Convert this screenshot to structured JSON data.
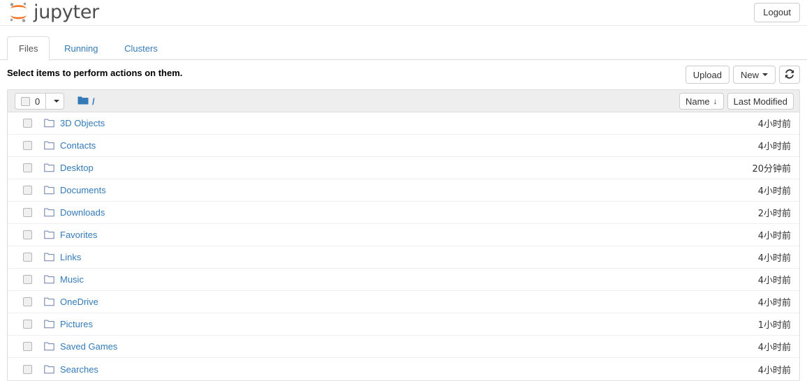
{
  "header": {
    "brand": "jupyter",
    "logo_icon": "jupyter-logo-icon",
    "logout_label": "Logout"
  },
  "tabs": [
    {
      "label": "Files",
      "active": true
    },
    {
      "label": "Running",
      "active": false
    },
    {
      "label": "Clusters",
      "active": false
    }
  ],
  "action_bar": {
    "hint": "Select items to perform actions on them.",
    "upload_label": "Upload",
    "new_label": "New",
    "refresh_icon": "refresh-icon"
  },
  "list_toolbar": {
    "select_count": "0",
    "select_caret_icon": "chevron-down-icon",
    "breadcrumb_folder_icon": "folder-filled-icon",
    "breadcrumb_root": "/",
    "sort_name_label": "Name",
    "sort_name_arrow": "↓",
    "sort_modified_label": "Last Modified"
  },
  "files": [
    {
      "name": "3D Objects",
      "icon": "folder-icon",
      "modified": "4小时前"
    },
    {
      "name": "Contacts",
      "icon": "folder-icon",
      "modified": "4小时前"
    },
    {
      "name": "Desktop",
      "icon": "folder-icon",
      "modified": "20分钟前"
    },
    {
      "name": "Documents",
      "icon": "folder-icon",
      "modified": "4小时前"
    },
    {
      "name": "Downloads",
      "icon": "folder-icon",
      "modified": "2小时前"
    },
    {
      "name": "Favorites",
      "icon": "folder-icon",
      "modified": "4小时前"
    },
    {
      "name": "Links",
      "icon": "folder-icon",
      "modified": "4小时前"
    },
    {
      "name": "Music",
      "icon": "folder-icon",
      "modified": "4小时前"
    },
    {
      "name": "OneDrive",
      "icon": "folder-icon",
      "modified": "4小时前"
    },
    {
      "name": "Pictures",
      "icon": "folder-icon",
      "modified": "1小时前"
    },
    {
      "name": "Saved Games",
      "icon": "folder-icon",
      "modified": "4小时前"
    },
    {
      "name": "Searches",
      "icon": "folder-icon",
      "modified": "4小时前"
    }
  ],
  "colors": {
    "link": "#337ab7",
    "logo_orange": "#f37726",
    "logo_gray": "#9e9e9e",
    "toolbar_bg": "#eeeeee",
    "border": "#dddddd"
  }
}
